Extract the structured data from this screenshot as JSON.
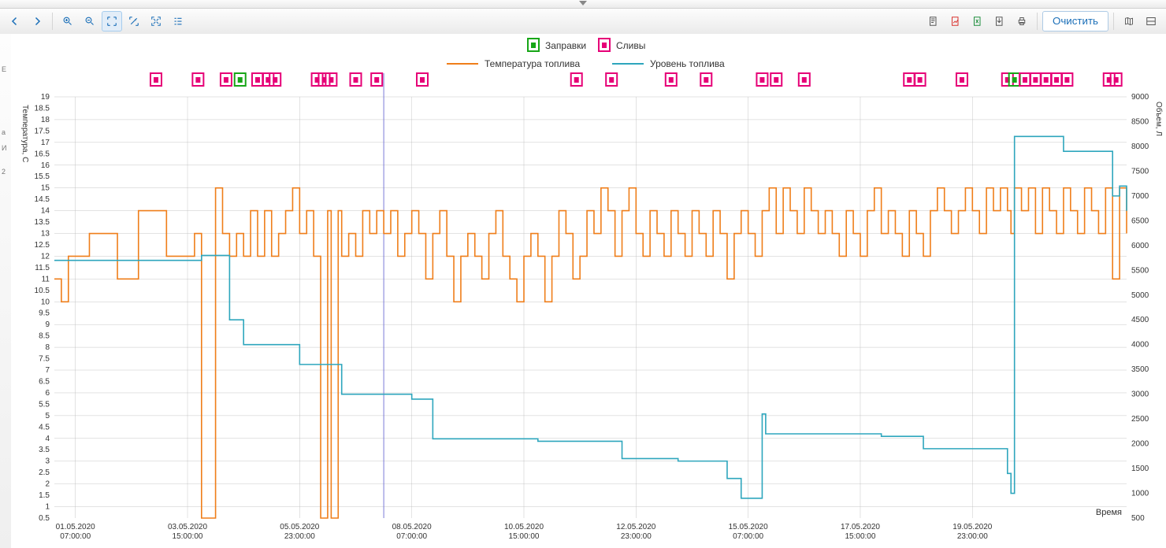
{
  "toolbar": {
    "clear_label": "Очистить"
  },
  "legend": {
    "refuels": "Заправки",
    "drains": "Сливы",
    "temperature": "Температура топлива",
    "level": "Уровень топлива"
  },
  "axes": {
    "y_left_label": "Температура, С",
    "y_right_label": "Объем, Л",
    "x_label": "Время",
    "y_left_min": 0.5,
    "y_left_max": 19,
    "y_left_step": 0.5,
    "y_right_min": 500,
    "y_right_max": 9000,
    "y_right_step": 500,
    "x_ticks": [
      {
        "t": 6,
        "l1": "01.05.2020",
        "l2": "07:00:00"
      },
      {
        "t": 38,
        "l1": "03.05.2020",
        "l2": "15:00:00"
      },
      {
        "t": 70,
        "l1": "05.05.2020",
        "l2": "23:00:00"
      },
      {
        "t": 102,
        "l1": "08.05.2020",
        "l2": "07:00:00"
      },
      {
        "t": 134,
        "l1": "10.05.2020",
        "l2": "15:00:00"
      },
      {
        "t": 166,
        "l1": "12.05.2020",
        "l2": "23:00:00"
      },
      {
        "t": 198,
        "l1": "15.05.2020",
        "l2": "07:00:00"
      },
      {
        "t": 230,
        "l1": "17.05.2020",
        "l2": "15:00:00"
      },
      {
        "t": 262,
        "l1": "19.05.2020",
        "l2": "23:00:00"
      }
    ]
  },
  "crosshair_t": 94,
  "markers": [
    {
      "t": 29,
      "type": "drain"
    },
    {
      "t": 41,
      "type": "drain"
    },
    {
      "t": 49,
      "type": "drain"
    },
    {
      "t": 53,
      "type": "refuel"
    },
    {
      "t": 58,
      "type": "drain"
    },
    {
      "t": 61,
      "type": "drain"
    },
    {
      "t": 63,
      "type": "drain"
    },
    {
      "t": 75,
      "type": "drain"
    },
    {
      "t": 77,
      "type": "drain"
    },
    {
      "t": 79,
      "type": "drain"
    },
    {
      "t": 86,
      "type": "drain"
    },
    {
      "t": 92,
      "type": "drain"
    },
    {
      "t": 105,
      "type": "drain"
    },
    {
      "t": 149,
      "type": "drain"
    },
    {
      "t": 159,
      "type": "drain"
    },
    {
      "t": 176,
      "type": "drain"
    },
    {
      "t": 186,
      "type": "drain"
    },
    {
      "t": 202,
      "type": "drain"
    },
    {
      "t": 206,
      "type": "drain"
    },
    {
      "t": 214,
      "type": "drain"
    },
    {
      "t": 244,
      "type": "drain"
    },
    {
      "t": 247,
      "type": "drain"
    },
    {
      "t": 259,
      "type": "drain"
    },
    {
      "t": 272,
      "type": "drain"
    },
    {
      "t": 274,
      "type": "refuel"
    },
    {
      "t": 277,
      "type": "drain"
    },
    {
      "t": 280,
      "type": "drain"
    },
    {
      "t": 283,
      "type": "drain"
    },
    {
      "t": 286,
      "type": "drain"
    },
    {
      "t": 289,
      "type": "drain"
    },
    {
      "t": 301,
      "type": "drain"
    },
    {
      "t": 303,
      "type": "drain"
    }
  ],
  "chart_data": {
    "type": "line",
    "title": "",
    "xlabel": "Время",
    "x_range_t": [
      0,
      306
    ],
    "series": [
      {
        "name": "Температура топлива",
        "axis": "left",
        "color": "#ef7e1a",
        "points": [
          [
            0,
            11
          ],
          [
            2,
            10
          ],
          [
            4,
            12
          ],
          [
            8,
            12
          ],
          [
            10,
            13
          ],
          [
            16,
            13
          ],
          [
            18,
            11
          ],
          [
            22,
            11
          ],
          [
            24,
            14
          ],
          [
            30,
            14
          ],
          [
            32,
            12
          ],
          [
            38,
            12
          ],
          [
            40,
            13
          ],
          [
            42,
            0.5
          ],
          [
            44,
            0.5
          ],
          [
            46,
            15
          ],
          [
            48,
            13
          ],
          [
            50,
            12
          ],
          [
            52,
            13
          ],
          [
            54,
            12
          ],
          [
            56,
            14
          ],
          [
            58,
            12
          ],
          [
            60,
            14
          ],
          [
            62,
            12
          ],
          [
            64,
            13
          ],
          [
            66,
            14
          ],
          [
            68,
            15
          ],
          [
            70,
            13
          ],
          [
            72,
            14
          ],
          [
            74,
            12
          ],
          [
            76,
            0.5
          ],
          [
            77,
            0.5
          ],
          [
            78,
            14
          ],
          [
            79,
            0.5
          ],
          [
            80,
            0.5
          ],
          [
            81,
            14
          ],
          [
            82,
            12
          ],
          [
            84,
            13
          ],
          [
            86,
            12
          ],
          [
            88,
            14
          ],
          [
            90,
            13
          ],
          [
            92,
            14
          ],
          [
            94,
            13
          ],
          [
            96,
            14
          ],
          [
            98,
            12
          ],
          [
            100,
            13
          ],
          [
            102,
            14
          ],
          [
            104,
            13
          ],
          [
            106,
            11
          ],
          [
            108,
            13
          ],
          [
            110,
            14
          ],
          [
            112,
            12
          ],
          [
            114,
            10
          ],
          [
            116,
            12
          ],
          [
            118,
            13
          ],
          [
            120,
            12
          ],
          [
            122,
            11
          ],
          [
            124,
            13
          ],
          [
            126,
            14
          ],
          [
            128,
            12
          ],
          [
            130,
            11
          ],
          [
            132,
            10
          ],
          [
            134,
            12
          ],
          [
            136,
            13
          ],
          [
            138,
            12
          ],
          [
            140,
            10
          ],
          [
            142,
            12
          ],
          [
            144,
            14
          ],
          [
            146,
            13
          ],
          [
            148,
            11
          ],
          [
            150,
            12
          ],
          [
            152,
            14
          ],
          [
            154,
            13
          ],
          [
            156,
            15
          ],
          [
            158,
            14
          ],
          [
            160,
            12
          ],
          [
            162,
            14
          ],
          [
            164,
            15
          ],
          [
            166,
            13
          ],
          [
            168,
            12
          ],
          [
            170,
            14
          ],
          [
            172,
            13
          ],
          [
            174,
            12
          ],
          [
            176,
            14
          ],
          [
            178,
            13
          ],
          [
            180,
            12
          ],
          [
            182,
            14
          ],
          [
            184,
            13
          ],
          [
            186,
            12
          ],
          [
            188,
            14
          ],
          [
            190,
            13
          ],
          [
            192,
            11
          ],
          [
            194,
            13
          ],
          [
            196,
            14
          ],
          [
            198,
            13
          ],
          [
            200,
            12
          ],
          [
            202,
            14
          ],
          [
            204,
            15
          ],
          [
            206,
            13
          ],
          [
            208,
            15
          ],
          [
            210,
            14
          ],
          [
            212,
            13
          ],
          [
            214,
            15
          ],
          [
            216,
            14
          ],
          [
            218,
            13
          ],
          [
            220,
            14
          ],
          [
            222,
            13
          ],
          [
            224,
            12
          ],
          [
            226,
            14
          ],
          [
            228,
            13
          ],
          [
            230,
            12
          ],
          [
            232,
            14
          ],
          [
            234,
            15
          ],
          [
            236,
            13
          ],
          [
            238,
            14
          ],
          [
            240,
            13
          ],
          [
            242,
            12
          ],
          [
            244,
            14
          ],
          [
            246,
            13
          ],
          [
            248,
            12
          ],
          [
            250,
            14
          ],
          [
            252,
            15
          ],
          [
            254,
            14
          ],
          [
            256,
            13
          ],
          [
            258,
            14
          ],
          [
            260,
            15
          ],
          [
            262,
            14
          ],
          [
            264,
            13
          ],
          [
            266,
            15
          ],
          [
            268,
            14
          ],
          [
            270,
            15
          ],
          [
            272,
            14
          ],
          [
            273,
            13
          ],
          [
            274,
            15
          ],
          [
            276,
            14
          ],
          [
            278,
            15
          ],
          [
            280,
            13
          ],
          [
            282,
            15
          ],
          [
            284,
            14
          ],
          [
            286,
            13
          ],
          [
            288,
            15
          ],
          [
            290,
            14
          ],
          [
            292,
            13
          ],
          [
            294,
            15
          ],
          [
            296,
            14
          ],
          [
            298,
            13
          ],
          [
            300,
            15
          ],
          [
            302,
            11
          ],
          [
            304,
            15
          ],
          [
            306,
            13
          ]
        ]
      },
      {
        "name": "Уровень топлива",
        "axis": "right",
        "color": "#2ea6bd",
        "points": [
          [
            0,
            5700
          ],
          [
            40,
            5700
          ],
          [
            42,
            5800
          ],
          [
            44,
            5800
          ],
          [
            50,
            4500
          ],
          [
            54,
            4000
          ],
          [
            58,
            4000
          ],
          [
            66,
            4000
          ],
          [
            70,
            3600
          ],
          [
            76,
            3600
          ],
          [
            82,
            3000
          ],
          [
            98,
            3000
          ],
          [
            102,
            2900
          ],
          [
            108,
            2100
          ],
          [
            132,
            2100
          ],
          [
            138,
            2050
          ],
          [
            158,
            2050
          ],
          [
            162,
            1700
          ],
          [
            172,
            1700
          ],
          [
            178,
            1650
          ],
          [
            186,
            1650
          ],
          [
            192,
            1300
          ],
          [
            196,
            900
          ],
          [
            200,
            900
          ],
          [
            202,
            2600
          ],
          [
            203,
            2200
          ],
          [
            232,
            2200
          ],
          [
            236,
            2150
          ],
          [
            244,
            2150
          ],
          [
            248,
            1900
          ],
          [
            270,
            1900
          ],
          [
            272,
            1400
          ],
          [
            273,
            1000
          ],
          [
            274,
            8200
          ],
          [
            284,
            8200
          ],
          [
            288,
            7900
          ],
          [
            300,
            7900
          ],
          [
            302,
            7000
          ],
          [
            304,
            7200
          ],
          [
            306,
            6700
          ]
        ]
      }
    ]
  }
}
